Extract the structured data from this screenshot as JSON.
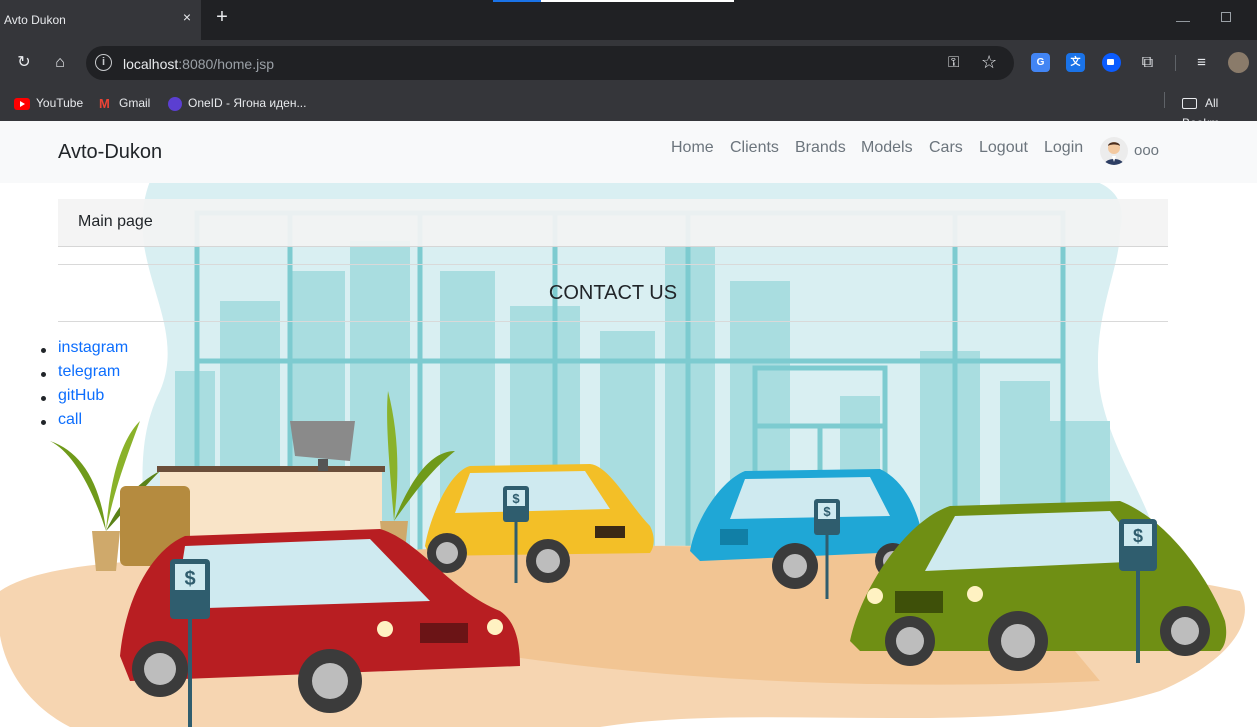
{
  "browser": {
    "tab_title": "Avto Dukon",
    "tab_close_icon": "×",
    "new_tab_icon": "+",
    "url_host": "localhost",
    "url_rest": ":8080/home.jsp",
    "bookmarks": [
      {
        "label": "YouTube"
      },
      {
        "label": "Gmail"
      },
      {
        "label": "OneID - Ягона иден..."
      }
    ],
    "all_bookmarks": "All Bookm",
    "ext_translate": "G",
    "ext_translate2": "文"
  },
  "site": {
    "brand": "Avto-Dukon",
    "nav": [
      {
        "label": "Home"
      },
      {
        "label": "Clients"
      },
      {
        "label": "Brands"
      },
      {
        "label": "Models"
      },
      {
        "label": "Cars"
      },
      {
        "label": "Logout"
      },
      {
        "label": "Login"
      }
    ],
    "user": "ooo",
    "breadcrumb": "Main page",
    "contact_heading": "CONTACT US",
    "contact_links": [
      {
        "label": "instagram"
      },
      {
        "label": "telegram"
      },
      {
        "label": "gitHub"
      },
      {
        "label": "call"
      }
    ],
    "price_sign": "$"
  },
  "colors": {
    "navbar_bg": "#f8f9fa",
    "link": "#0d6efd",
    "sky": "#d9eff2",
    "city": "#a9dde0",
    "floor": "#f2c593",
    "car_red": "#b81e22",
    "car_yellow": "#f3bf27",
    "car_blue": "#1fa7d6",
    "car_green": "#6f8f14"
  }
}
